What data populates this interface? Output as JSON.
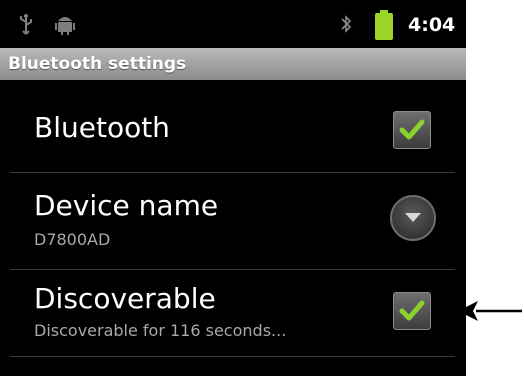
{
  "status_bar": {
    "usb_icon": "usb-icon",
    "android_icon": "android-debug-icon",
    "bluetooth_icon": "bluetooth-icon",
    "battery_icon": "battery-icon",
    "battery_color": "#9ad629",
    "time": "4:04"
  },
  "screen": {
    "title": "Bluetooth settings"
  },
  "settings": [
    {
      "title": "Bluetooth",
      "summary": "",
      "control": "checkbox",
      "checked": true
    },
    {
      "title": "Device name",
      "summary": "D7800AD",
      "control": "dropdown"
    },
    {
      "title": "Discoverable",
      "summary": "Discoverable for 116 seconds...",
      "control": "checkbox",
      "checked": true
    }
  ],
  "colors": {
    "check_green": "#8ad12e",
    "background": "#000000",
    "title_bar": "#a0a0a0"
  }
}
